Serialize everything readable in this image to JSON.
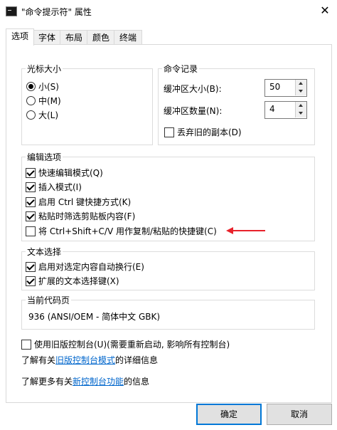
{
  "window": {
    "title": "\"命令提示符\" 属性",
    "close_glyph": "✕"
  },
  "tabs": [
    {
      "label": "选项"
    },
    {
      "label": "字体"
    },
    {
      "label": "布局"
    },
    {
      "label": "颜色"
    },
    {
      "label": "终端"
    }
  ],
  "cursor_size": {
    "title": "光标大小",
    "options": [
      {
        "label": "小(S)",
        "selected": true
      },
      {
        "label": "中(M)",
        "selected": false
      },
      {
        "label": "大(L)",
        "selected": false
      }
    ]
  },
  "command_history": {
    "title": "命令记录",
    "buffer_size_label": "缓冲区大小(B):",
    "buffer_size_value": "50",
    "buffer_count_label": "缓冲区数量(N):",
    "buffer_count_value": "4",
    "discard_label": "丢弃旧的副本(D)",
    "discard_checked": false
  },
  "edit_options": {
    "title": "编辑选项",
    "items": [
      {
        "label": "快速编辑模式(Q)",
        "checked": true
      },
      {
        "label": "插入模式(I)",
        "checked": true
      },
      {
        "label": "启用 Ctrl 键快捷方式(K)",
        "checked": true
      },
      {
        "label": "粘贴时筛选剪贴板内容(F)",
        "checked": true
      },
      {
        "label": "将 Ctrl+Shift+C/V 用作复制/粘贴的快捷键(C)",
        "checked": false
      }
    ]
  },
  "text_selection": {
    "title": "文本选择",
    "items": [
      {
        "label": "启用对选定内容自动换行(E)",
        "checked": true
      },
      {
        "label": "扩展的文本选择键(X)",
        "checked": true
      }
    ]
  },
  "codepage": {
    "title": "当前代码页",
    "value": "936   (ANSI/OEM - 简体中文 GBK)"
  },
  "legacy": {
    "label": "使用旧版控制台(U)(需要重新启动, 影响所有控制台)",
    "checked": false
  },
  "info1": {
    "prefix": "了解有关",
    "link": "旧版控制台模式",
    "suffix": "的详细信息"
  },
  "info2": {
    "prefix": "了解更多有关",
    "link": "新控制台功能",
    "suffix": "的信息"
  },
  "buttons": {
    "ok": "确定",
    "cancel": "取消"
  },
  "colors": {
    "accent": "#0078d7",
    "annotation_arrow": "#e8222b",
    "link": "#0066cc"
  }
}
